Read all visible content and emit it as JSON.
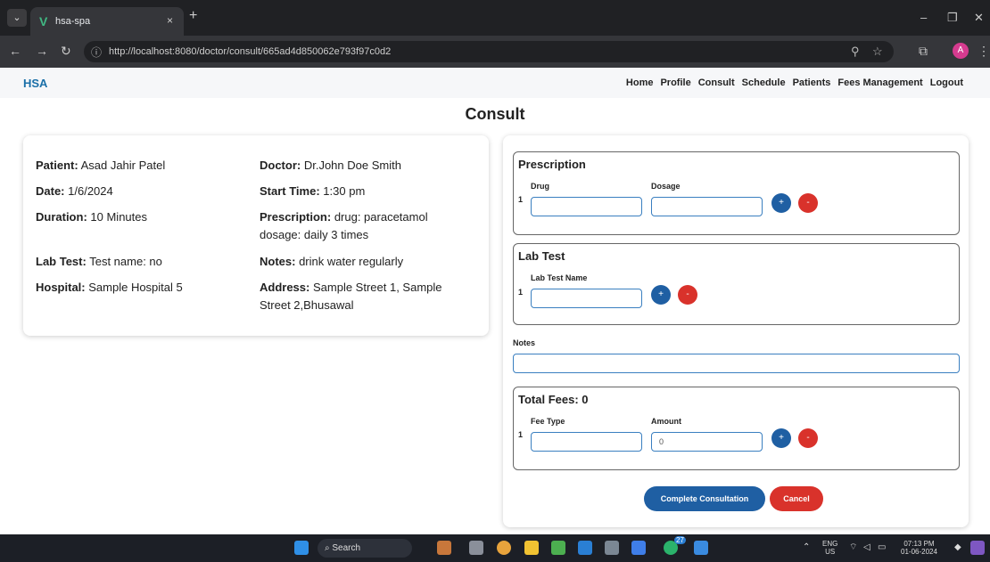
{
  "browser": {
    "tab_title": "hsa-spa",
    "tab_close": "×",
    "new_tab": "+",
    "url": "http://localhost:8080/doctor/consult/665ad4d850062e793f97c0d2",
    "profile_initial": "A"
  },
  "app": {
    "brand": "HSA",
    "nav": [
      "Home",
      "Profile",
      "Consult",
      "Schedule",
      "Patients",
      "Fees Management",
      "Logout"
    ],
    "page_title": "Consult"
  },
  "details": {
    "patient": {
      "label": "Patient:",
      "value": "Asad Jahir Patel"
    },
    "date": {
      "label": "Date:",
      "value": "1/6/2024"
    },
    "duration": {
      "label": "Duration:",
      "value": "10 Minutes"
    },
    "lab_test": {
      "label": "Lab Test:",
      "value": "Test name: no"
    },
    "hospital": {
      "label": "Hospital:",
      "value": "Sample Hospital 5"
    },
    "doctor": {
      "label": "Doctor:",
      "value": "Dr.John Doe Smith"
    },
    "start_time": {
      "label": "Start Time:",
      "value": "1:30 pm"
    },
    "prescription": {
      "label": "Prescription:",
      "value_line1": "drug: paracetamol",
      "value_line2": "dosage: daily 3 times"
    },
    "notes": {
      "label": "Notes:",
      "value": "drink water regularly"
    },
    "address": {
      "label": "Address:",
      "value_line1": "Sample Street 1, Sample",
      "value_line2": "Street 2,Bhusawal"
    }
  },
  "form": {
    "prescription": {
      "title": "Prescription",
      "col1": "Drug",
      "col2": "Dosage",
      "row": "1",
      "drug_value": "",
      "dosage_value": ""
    },
    "lab_test": {
      "title": "Lab Test",
      "col1": "Lab Test Name",
      "row": "1",
      "value": ""
    },
    "notes": {
      "label": "Notes",
      "value": ""
    },
    "fees": {
      "title": "Total Fees: 0",
      "col1": "Fee Type",
      "col2": "Amount",
      "row": "1",
      "fee_type_value": "",
      "amount_value": "0"
    },
    "add_symbol": "+",
    "remove_symbol": "-",
    "complete_label": "Complete Consultation",
    "cancel_label": "Cancel"
  },
  "taskbar": {
    "search_label": "Search",
    "notification_count": "27",
    "lang_line1": "ENG",
    "lang_line2": "US",
    "time": "07:13 PM",
    "date": "01-06-2024"
  },
  "colors": {
    "brand": "#1a6fa8",
    "add_button": "#1f5fa3",
    "remove_button": "#d9322b",
    "input_border": "#3a7fc0"
  }
}
